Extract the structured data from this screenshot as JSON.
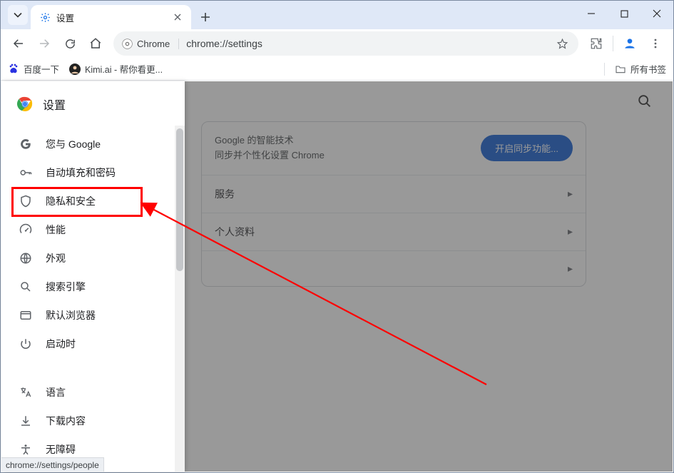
{
  "window": {
    "tab_title": "设置",
    "win_controls": {
      "min": "minimize",
      "max": "maximize",
      "close": "close"
    }
  },
  "toolbar": {
    "chip_label": "Chrome",
    "url": "chrome://settings"
  },
  "bookmarks": {
    "items": [
      {
        "label": "百度一下"
      },
      {
        "label": "Kimi.ai - 帮你看更..."
      }
    ],
    "all_label": "所有书签"
  },
  "drawer": {
    "title": "设置",
    "items": [
      {
        "icon": "google",
        "label": "您与 Google"
      },
      {
        "icon": "key",
        "label": "自动填充和密码"
      },
      {
        "icon": "shield",
        "label": "隐私和安全"
      },
      {
        "icon": "gauge",
        "label": "性能"
      },
      {
        "icon": "globe",
        "label": "外观"
      },
      {
        "icon": "search",
        "label": "搜索引擎"
      },
      {
        "icon": "browser",
        "label": "默认浏览器"
      },
      {
        "icon": "power",
        "label": "启动时"
      }
    ],
    "items2": [
      {
        "icon": "lang",
        "label": "语言"
      },
      {
        "icon": "download",
        "label": "下载内容"
      },
      {
        "icon": "a11y",
        "label": "无障碍"
      }
    ]
  },
  "main": {
    "sync": {
      "line1": "Google 的智能技术",
      "line2": "同步并个性化设置 Chrome",
      "button": "开启同步功能..."
    },
    "rows": [
      {
        "label": "服务"
      },
      {
        "label": "个人资料"
      },
      {
        "label": ""
      }
    ]
  },
  "status_url": "chrome://settings/people",
  "annotation": {
    "highlight_target": "隐私和安全"
  }
}
